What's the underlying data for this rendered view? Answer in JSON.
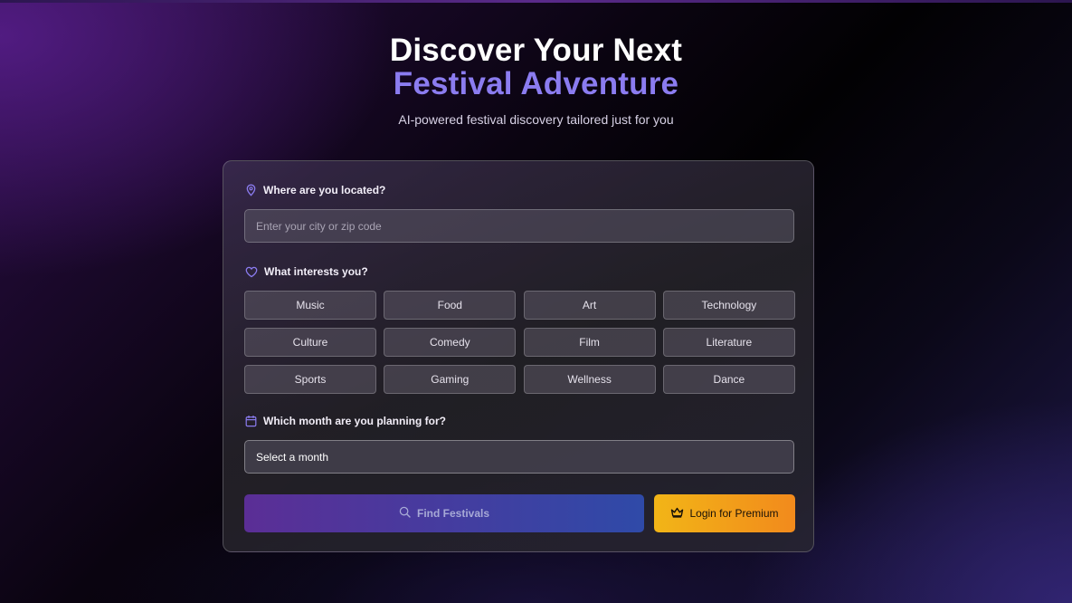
{
  "hero": {
    "title_line1": "Discover Your Next",
    "title_line2": "Festival Adventure",
    "subtitle": "AI-powered festival discovery tailored just for you"
  },
  "location": {
    "label": "Where are you located?",
    "icon": "map-pin-icon",
    "placeholder": "Enter your city or zip code",
    "value": ""
  },
  "interests": {
    "label": "What interests you?",
    "icon": "heart-icon",
    "options": [
      "Music",
      "Food",
      "Art",
      "Technology",
      "Culture",
      "Comedy",
      "Film",
      "Literature",
      "Sports",
      "Gaming",
      "Wellness",
      "Dance"
    ]
  },
  "month": {
    "label": "Which month are you planning for?",
    "icon": "calendar-icon",
    "selected": "Select a month"
  },
  "actions": {
    "find_label": "Find Festivals",
    "find_icon": "search-icon",
    "premium_label": "Login for Premium",
    "premium_icon": "crown-icon"
  },
  "colors": {
    "accent": "#8b7cf0",
    "find_gradient_start": "#5b2e96",
    "find_gradient_end": "#2f4aa8",
    "premium_gradient_start": "#f2b517",
    "premium_gradient_end": "#f28a1c"
  }
}
